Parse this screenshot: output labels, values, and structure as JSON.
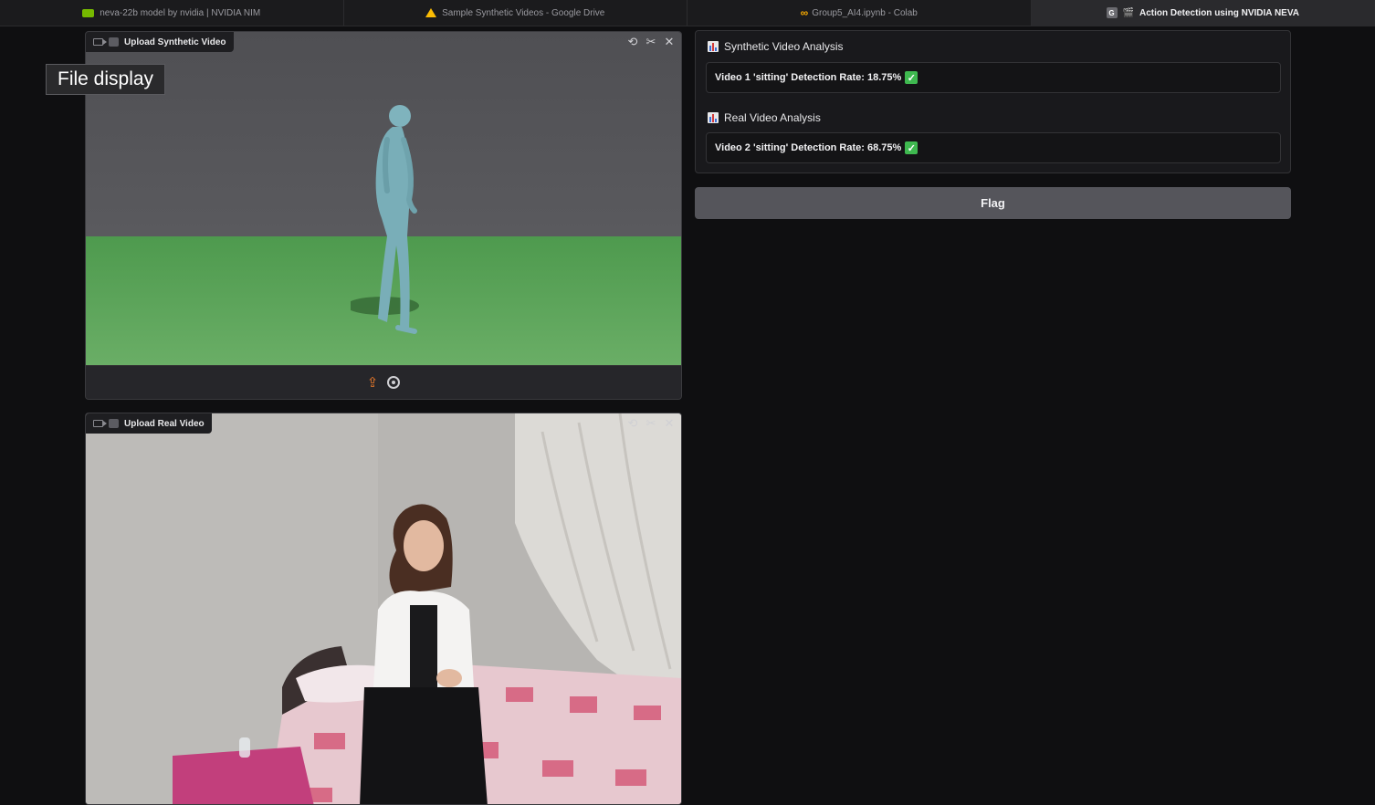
{
  "browser": {
    "tabs": [
      {
        "title": "neva-22b model by nvidia | NVIDIA NIM",
        "icon": "nvidia-icon",
        "active": false
      },
      {
        "title": "Sample Synthetic Videos - Google Drive",
        "icon": "google-drive-icon",
        "active": false
      },
      {
        "title": "Group5_AI4.ipynb - Colab",
        "icon": "colab-icon",
        "active": false
      },
      {
        "title": "Action Detection using NVIDIA NEVA",
        "icon": "clapperboard-icon",
        "active": true
      }
    ]
  },
  "tooltip": {
    "text": "File display"
  },
  "synthetic_video": {
    "label": "Upload Synthetic Video"
  },
  "real_video": {
    "label": "Upload Real Video"
  },
  "analysis": {
    "synthetic": {
      "title": "Synthetic Video Analysis",
      "result": "Video 1 'sitting' Detection Rate: 18.75%"
    },
    "real": {
      "title": "Real Video Analysis",
      "result": "Video 2 'sitting' Detection Rate: 68.75%"
    }
  },
  "flag_button": {
    "label": "Flag"
  },
  "colors": {
    "accent_green": "#3fb950",
    "upload_orange": "#f07c2a",
    "nvidia_green": "#76b900"
  }
}
